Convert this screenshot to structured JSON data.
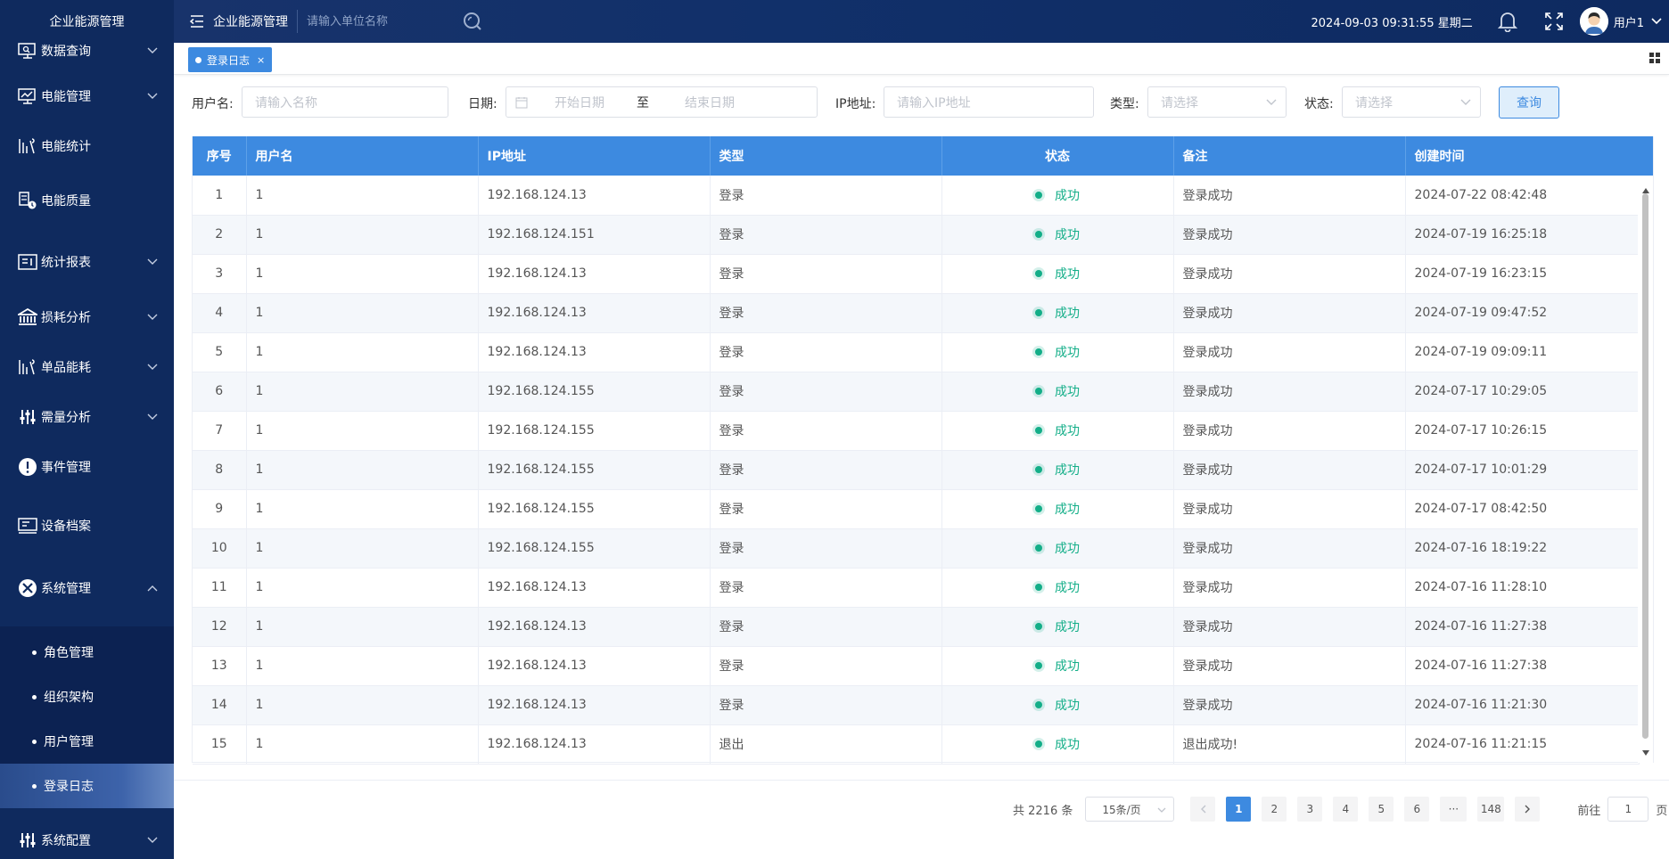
{
  "brand": "企业能源管理",
  "sidebar": {
    "items": [
      {
        "label": "数据查询",
        "icon": "monitor-search-icon",
        "expandable": true
      },
      {
        "label": "电能管理",
        "icon": "monitor-chart-icon",
        "expandable": true
      },
      {
        "label": "电能统计",
        "icon": "stats-bars-icon",
        "expandable": false
      },
      {
        "label": "电能质量",
        "icon": "quality-meter-icon",
        "expandable": false
      },
      {
        "label": "统计报表",
        "icon": "report-icon",
        "expandable": true
      },
      {
        "label": "损耗分析",
        "icon": "bank-icon",
        "expandable": true
      },
      {
        "label": "单品能耗",
        "icon": "product-energy-icon",
        "expandable": true
      },
      {
        "label": "需量分析",
        "icon": "sliders-icon",
        "expandable": true
      },
      {
        "label": "事件管理",
        "icon": "alert-icon",
        "expandable": false
      },
      {
        "label": "设备档案",
        "icon": "device-icon",
        "expandable": false
      },
      {
        "label": "系统管理",
        "icon": "tools-icon",
        "expandable": true,
        "expanded": true
      },
      {
        "label": "系统配置",
        "icon": "sliders-icon",
        "expandable": true
      }
    ],
    "system_sub": [
      {
        "label": "角色管理"
      },
      {
        "label": "组织架构"
      },
      {
        "label": "用户管理"
      },
      {
        "label": "登录日志",
        "active": true
      }
    ]
  },
  "header": {
    "title": "企业能源管理",
    "search_placeholder": "请输入单位名称",
    "datetime": "2024-09-03 09:31:55 星期二",
    "username": "用户1"
  },
  "tabs": [
    {
      "label": "登录日志",
      "close": "×"
    }
  ],
  "filters": {
    "username_label": "用户名:",
    "username_placeholder": "请输入名称",
    "date_label": "日期:",
    "start_placeholder": "开始日期",
    "date_sep": "至",
    "end_placeholder": "结束日期",
    "ip_label": "IP地址:",
    "ip_placeholder": "请输入IP地址",
    "type_label": "类型:",
    "type_placeholder": "请选择",
    "status_label": "状态:",
    "status_placeholder": "请选择",
    "query_label": "查询"
  },
  "table": {
    "columns": [
      "序号",
      "用户名",
      "IP地址",
      "类型",
      "状态",
      "备注",
      "创建时间"
    ],
    "rows": [
      {
        "no": "1",
        "user": "1",
        "ip": "192.168.124.13",
        "type": "登录",
        "status": "成功",
        "note": "登录成功",
        "time": "2024-07-22 08:42:48"
      },
      {
        "no": "2",
        "user": "1",
        "ip": "192.168.124.151",
        "type": "登录",
        "status": "成功",
        "note": "登录成功",
        "time": "2024-07-19 16:25:18"
      },
      {
        "no": "3",
        "user": "1",
        "ip": "192.168.124.13",
        "type": "登录",
        "status": "成功",
        "note": "登录成功",
        "time": "2024-07-19 16:23:15"
      },
      {
        "no": "4",
        "user": "1",
        "ip": "192.168.124.13",
        "type": "登录",
        "status": "成功",
        "note": "登录成功",
        "time": "2024-07-19 09:47:52"
      },
      {
        "no": "5",
        "user": "1",
        "ip": "192.168.124.13",
        "type": "登录",
        "status": "成功",
        "note": "登录成功",
        "time": "2024-07-19 09:09:11"
      },
      {
        "no": "6",
        "user": "1",
        "ip": "192.168.124.155",
        "type": "登录",
        "status": "成功",
        "note": "登录成功",
        "time": "2024-07-17 10:29:05"
      },
      {
        "no": "7",
        "user": "1",
        "ip": "192.168.124.155",
        "type": "登录",
        "status": "成功",
        "note": "登录成功",
        "time": "2024-07-17 10:26:15"
      },
      {
        "no": "8",
        "user": "1",
        "ip": "192.168.124.155",
        "type": "登录",
        "status": "成功",
        "note": "登录成功",
        "time": "2024-07-17 10:01:29"
      },
      {
        "no": "9",
        "user": "1",
        "ip": "192.168.124.155",
        "type": "登录",
        "status": "成功",
        "note": "登录成功",
        "time": "2024-07-17 08:42:50"
      },
      {
        "no": "10",
        "user": "1",
        "ip": "192.168.124.155",
        "type": "登录",
        "status": "成功",
        "note": "登录成功",
        "time": "2024-07-16 18:19:22"
      },
      {
        "no": "11",
        "user": "1",
        "ip": "192.168.124.13",
        "type": "登录",
        "status": "成功",
        "note": "登录成功",
        "time": "2024-07-16 11:28:10"
      },
      {
        "no": "12",
        "user": "1",
        "ip": "192.168.124.13",
        "type": "登录",
        "status": "成功",
        "note": "登录成功",
        "time": "2024-07-16 11:27:38"
      },
      {
        "no": "13",
        "user": "1",
        "ip": "192.168.124.13",
        "type": "登录",
        "status": "成功",
        "note": "登录成功",
        "time": "2024-07-16 11:27:38"
      },
      {
        "no": "14",
        "user": "1",
        "ip": "192.168.124.13",
        "type": "登录",
        "status": "成功",
        "note": "登录成功",
        "time": "2024-07-16 11:21:30"
      },
      {
        "no": "15",
        "user": "1",
        "ip": "192.168.124.13",
        "type": "退出",
        "status": "成功",
        "note": "退出成功!",
        "time": "2024-07-16 11:21:15"
      }
    ]
  },
  "pagination": {
    "total": "共 2216 条",
    "page_size": "15条/页",
    "pages": [
      "1",
      "2",
      "3",
      "4",
      "5",
      "6",
      "···",
      "148"
    ],
    "current": "1",
    "goto_label": "前往",
    "goto_value": "1",
    "goto_suffix": "页"
  },
  "colors": {
    "sidebar_bg": "#0f2a5e",
    "header_bg": "#11306a",
    "accent": "#3d8ae0",
    "success": "#13ae88"
  }
}
